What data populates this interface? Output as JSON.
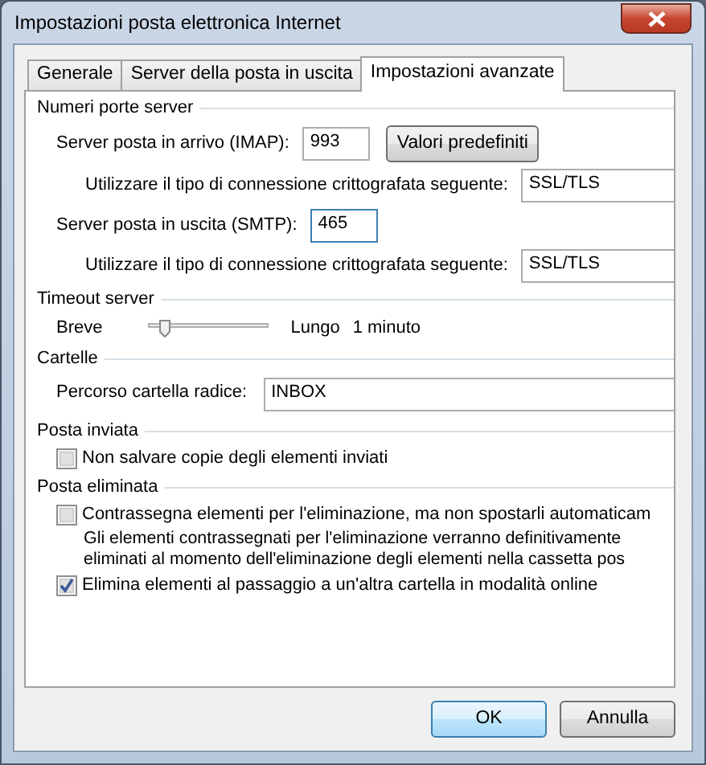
{
  "window": {
    "title": "Impostazioni posta elettronica Internet"
  },
  "tabs": [
    {
      "label": "Generale",
      "selected": false
    },
    {
      "label": "Server della posta in uscita",
      "selected": false
    },
    {
      "label": "Impostazioni avanzate",
      "selected": true
    }
  ],
  "server_ports": {
    "heading": "Numeri porte server",
    "incoming": {
      "label": "Server posta in arrivo (IMAP):",
      "value": "993"
    },
    "defaults_button": "Valori predefiniti",
    "incoming_encryption": {
      "label": "Utilizzare il tipo di connessione crittografata seguente:",
      "value": "SSL/TLS"
    },
    "outgoing": {
      "label": "Server posta in uscita (SMTP):",
      "value": "465",
      "focused": true
    },
    "outgoing_encryption": {
      "label": "Utilizzare il tipo di connessione crittografata seguente:",
      "value": "SSL/TLS"
    }
  },
  "timeout": {
    "heading": "Timeout server",
    "min_label": "Breve",
    "max_label": "Lungo",
    "level": 0.1,
    "reading": "1 minuto"
  },
  "folders": {
    "heading": "Cartelle",
    "root_label": "Percorso cartella radice:",
    "root_value": "INBOX"
  },
  "sent_mail": {
    "heading": "Posta inviata",
    "options": [
      {
        "label": "Non salvare copie degli elementi inviati",
        "checked": false
      }
    ]
  },
  "deleted_mail": {
    "heading": "Posta eliminata",
    "options": [
      {
        "label": "Contrassegna elementi per l'eliminazione, ma non spostarli automaticam",
        "checked": false,
        "note": "Gli elementi contrassegnati per l'eliminazione verranno definitivamente eliminati al momento dell'eliminazione degli elementi nella cassetta pos"
      },
      {
        "label": "Elimina elementi al passaggio a un'altra cartella in modalità online",
        "checked": true
      }
    ]
  },
  "buttons": [
    {
      "label": "OK",
      "default": true
    },
    {
      "label": "Annulla",
      "default": false
    }
  ]
}
